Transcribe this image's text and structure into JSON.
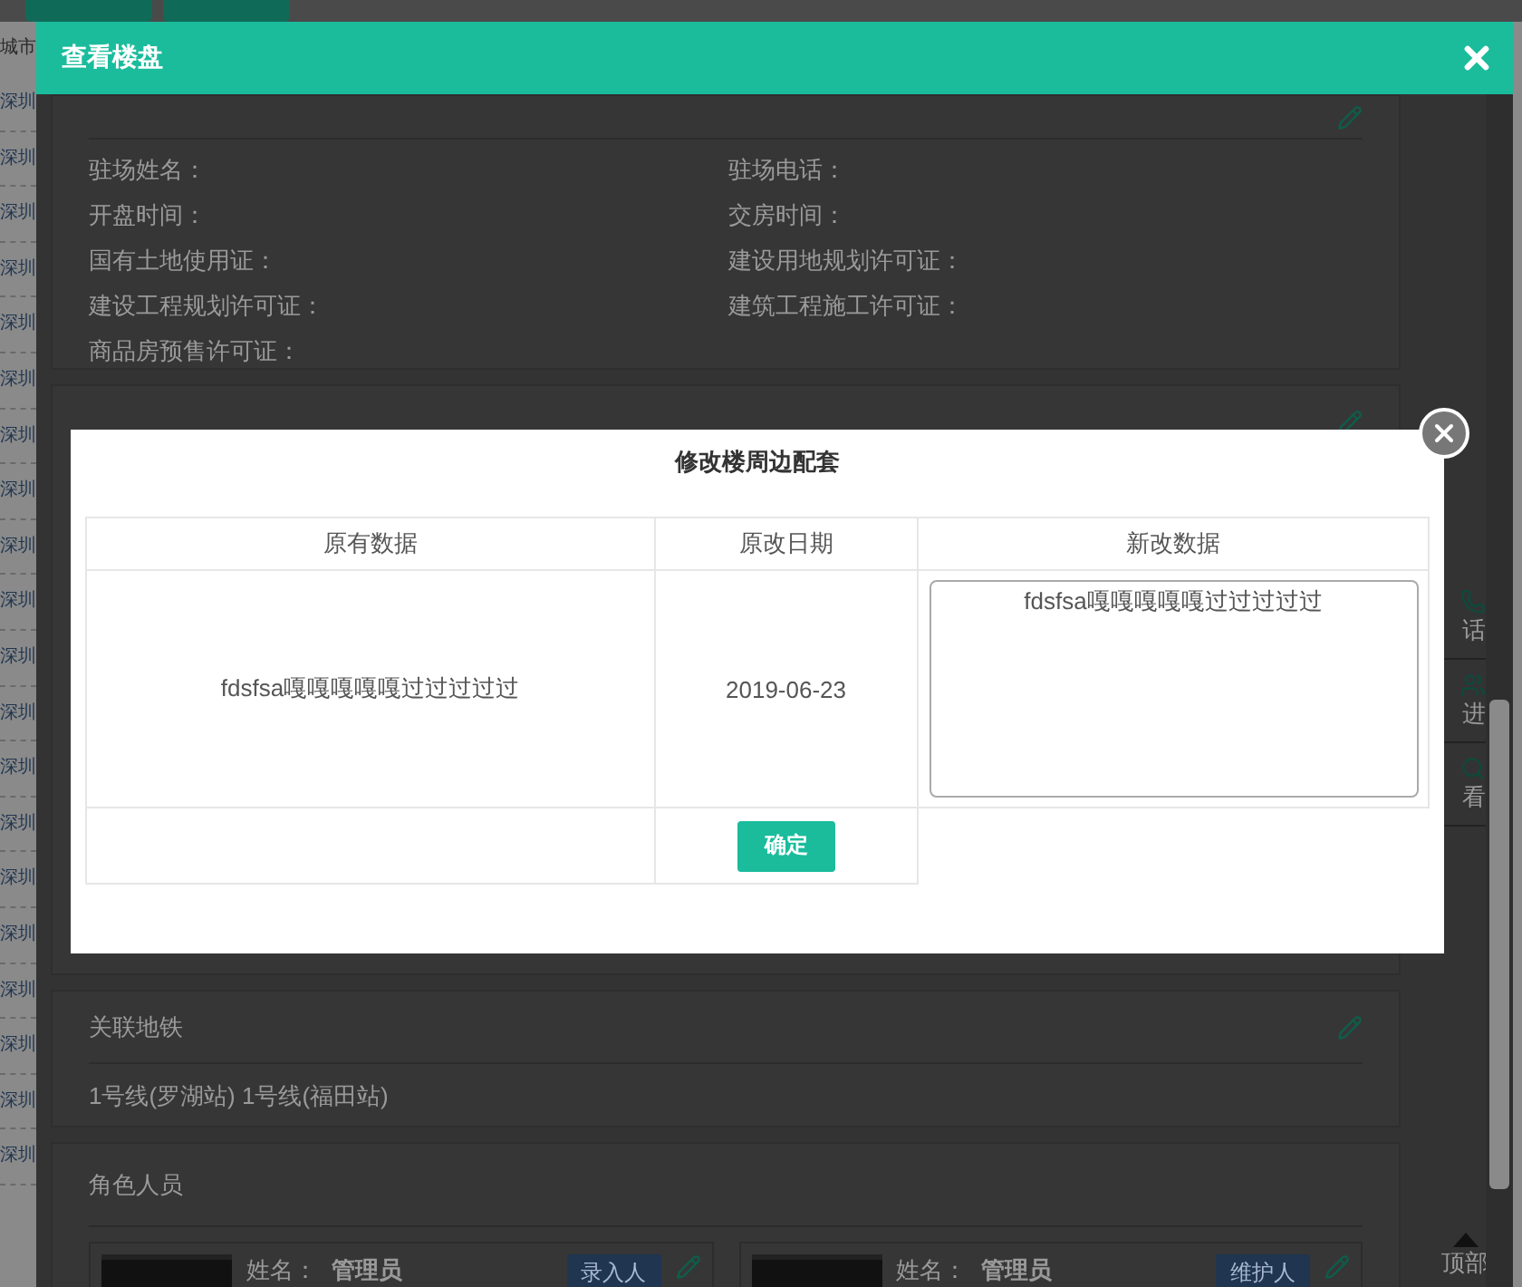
{
  "background": {
    "city_header": "城市",
    "city_rows": [
      "深圳",
      "深圳",
      "深圳",
      "深圳",
      "深圳",
      "深圳",
      "深圳",
      "深圳",
      "深圳",
      "深圳",
      "深圳",
      "深圳",
      "深圳",
      "深圳",
      "深圳",
      "深圳",
      "深圳",
      "深圳",
      "深圳",
      "深圳"
    ]
  },
  "dialog": {
    "title": "查看楼盘",
    "fields": [
      {
        "label": "驻场姓名："
      },
      {
        "label": "驻场电话："
      },
      {
        "label": "开盘时间："
      },
      {
        "label": "交房时间："
      },
      {
        "label": "国有土地使用证："
      },
      {
        "label": "建设用地规划许可证："
      },
      {
        "label": "建设工程规划许可证："
      },
      {
        "label": "建筑工程施工许可证："
      },
      {
        "label": "商品房预售许可证："
      }
    ],
    "subway": {
      "title": "关联地铁",
      "text": "1号线(罗湖站) 1号线(福田站)"
    },
    "roles": {
      "title": "角色人员",
      "people": [
        {
          "name_label": "姓名：",
          "name": "管理员",
          "role": "录入人"
        },
        {
          "name_label": "姓名：",
          "name": "管理员",
          "role": "维护人"
        }
      ]
    },
    "rail": [
      "话",
      "进",
      "看"
    ],
    "top_link": "顶部"
  },
  "modal": {
    "title": "修改楼周边配套",
    "columns": [
      "原有数据",
      "原改日期",
      "新改数据"
    ],
    "row": {
      "original": "fdsfsa嘎嘎嘎嘎嘎过过过过过",
      "date": "2019-06-23",
      "new_value": "fdsfsa嘎嘎嘎嘎嘎过过过过过"
    },
    "confirm": "确定"
  }
}
